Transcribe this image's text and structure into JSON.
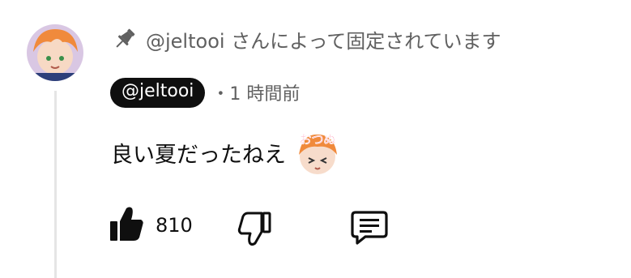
{
  "comment": {
    "pinned_by_text": "@jeltooi さんによって固定されています",
    "author": "@jeltooi",
    "timestamp": "・1 時間前",
    "text": "良い夏だったねえ",
    "emoji_label": "おつぬ",
    "like_count": "810",
    "icons": {
      "pin": "pin-icon",
      "like": "thumbs-up-icon",
      "dislike": "thumbs-down-icon",
      "reply": "comment-reply-icon"
    },
    "colors": {
      "text": "#0f0f0f",
      "secondary_text": "#606060",
      "chip_bg": "#0f0f0f",
      "thread_line": "#e5e5e5"
    }
  }
}
